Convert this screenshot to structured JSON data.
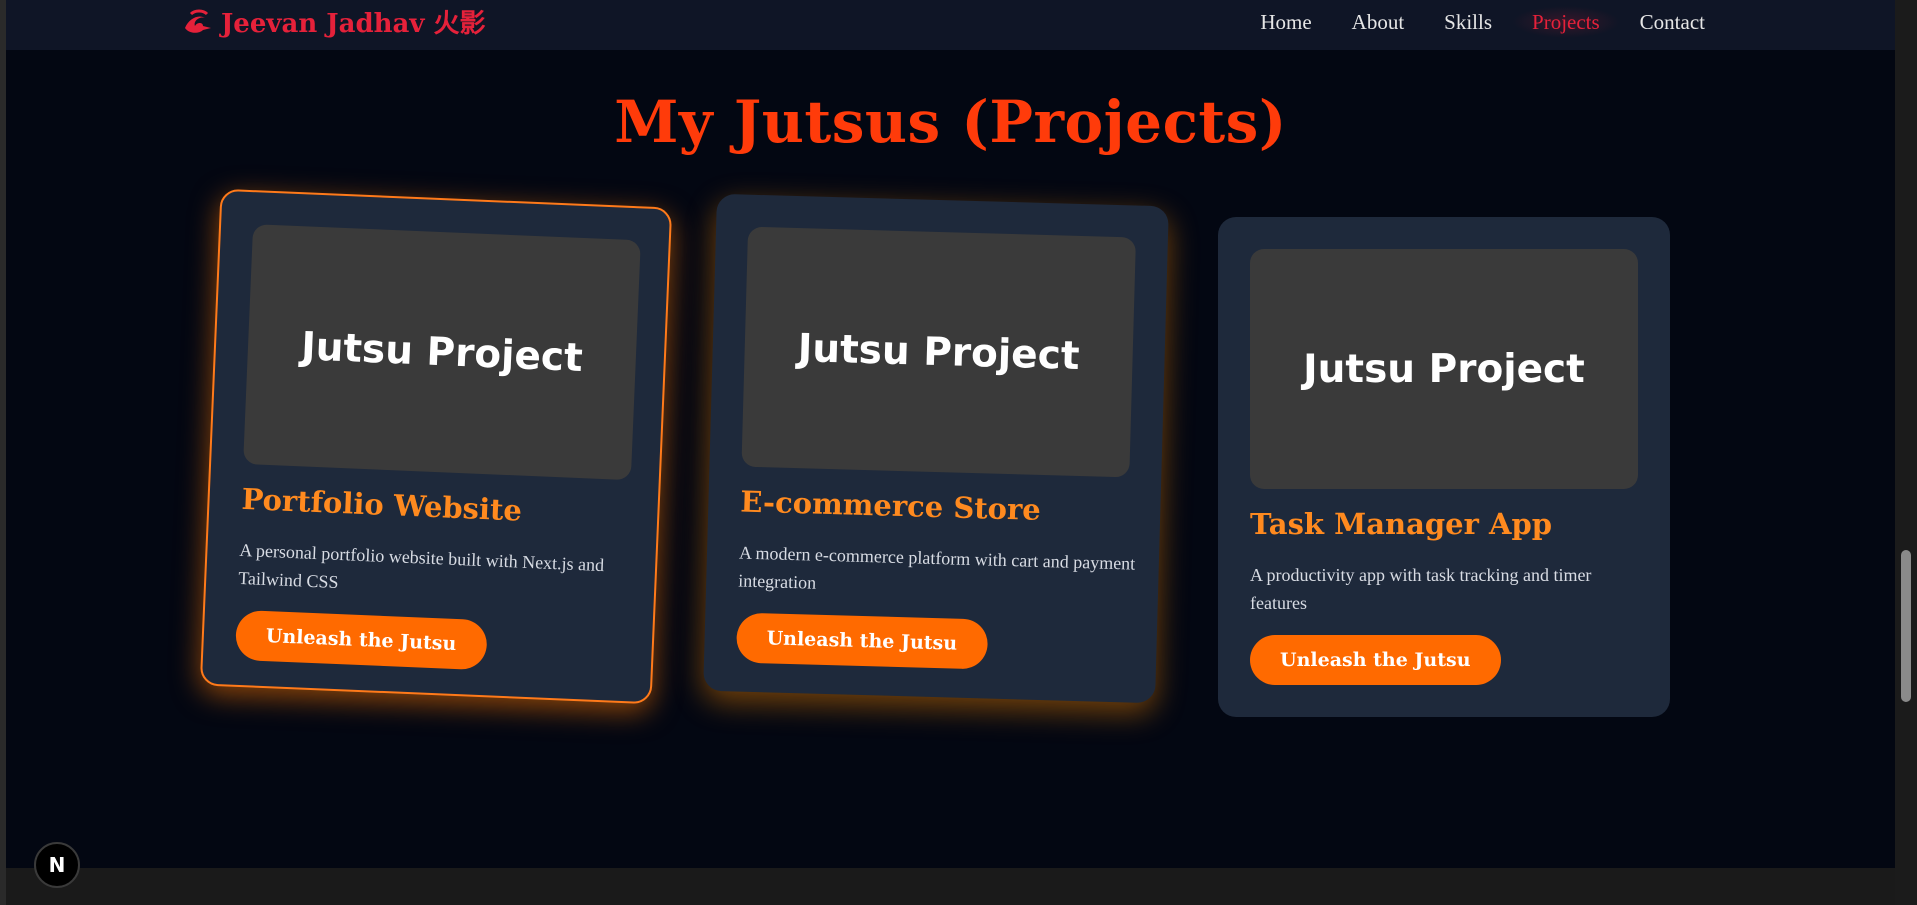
{
  "brand": {
    "name": "Jeevan Jadhav 火影",
    "logo_icon": "swirl-logo-icon",
    "color": "#e5213a"
  },
  "nav": {
    "items": [
      {
        "label": "Home",
        "active": false
      },
      {
        "label": "About",
        "active": false
      },
      {
        "label": "Skills",
        "active": false
      },
      {
        "label": "Projects",
        "active": true
      },
      {
        "label": "Contact",
        "active": false
      }
    ]
  },
  "section": {
    "title": "My Jutsus (Projects)"
  },
  "projects": [
    {
      "thumb_label": "Jutsu Project",
      "title": "Portfolio Website",
      "description": "A personal portfolio website built with Next.js and Tailwind CSS",
      "button": "Unleash the Jutsu"
    },
    {
      "thumb_label": "Jutsu Project",
      "title": "E-commerce Store",
      "description": "A modern e-commerce platform with cart and payment integration",
      "button": "Unleash the Jutsu"
    },
    {
      "thumb_label": "Jutsu Project",
      "title": "Task Manager App",
      "description": "A productivity app with task tracking and timer features",
      "button": "Unleash the Jutsu"
    }
  ],
  "dev_badge": {
    "label": "N",
    "icon": "nextjs-icon"
  },
  "colors": {
    "accent_title": "#ff3b0a",
    "card_title": "#ff8a1f",
    "button": "#ff6a00",
    "card_bg": "#1e293b",
    "page_bg": "#030712"
  }
}
